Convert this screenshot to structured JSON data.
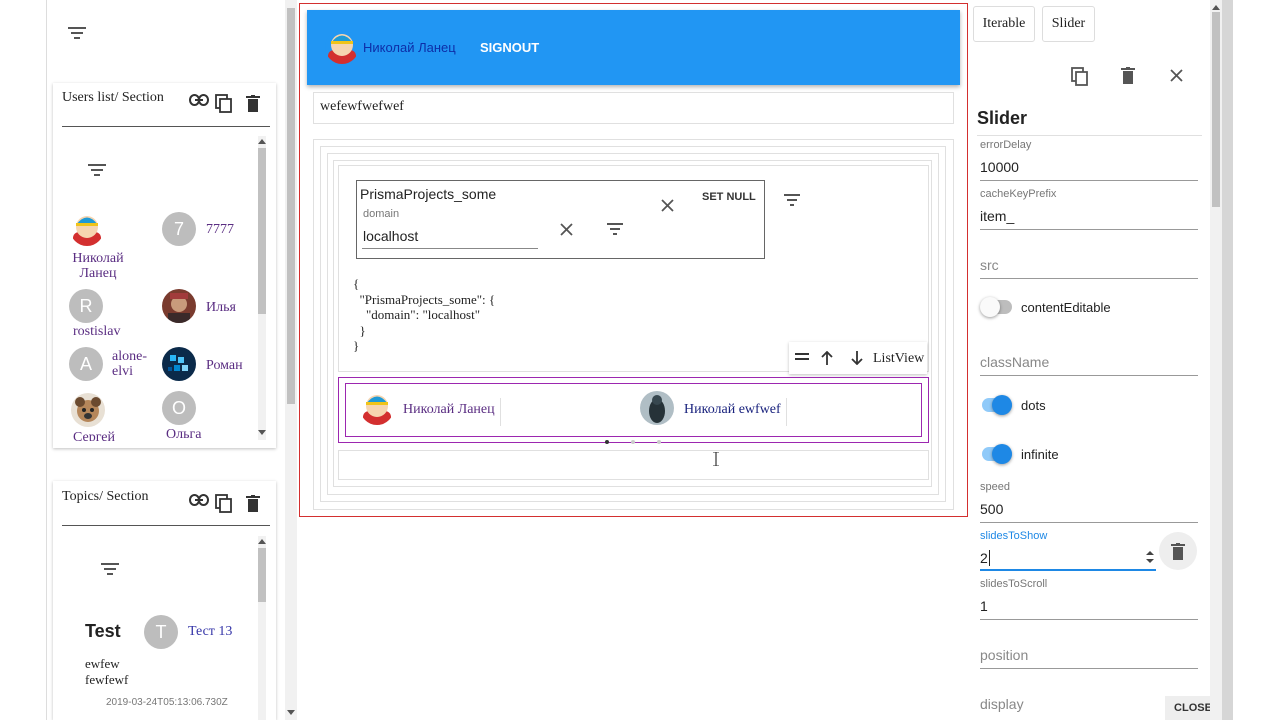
{
  "left": {
    "users_section": {
      "title": "Users list/ Section",
      "users": [
        {
          "name": "Николай\nЛанец",
          "avatar": "cartman-avatar"
        },
        {
          "name": "7777",
          "letter": "7"
        },
        {
          "name": "rostislav",
          "letter": "R"
        },
        {
          "name": "Илья",
          "avatar": "photo-avatar"
        },
        {
          "name": "alone-\nelvi",
          "letter": "A"
        },
        {
          "name": "Роман",
          "avatar": "pixel-avatar"
        },
        {
          "name": "Сергей",
          "avatar": "dog-avatar"
        },
        {
          "name": "Ольга",
          "letter": "O"
        }
      ]
    },
    "topics_section": {
      "title": "Topics/ Section",
      "topic_title": "Test",
      "topic_body": "ewfew\nfewfewf",
      "topic_date": "2019-03-24T05:13:06.730Z",
      "user_letter": "T",
      "user_name": "Тест 13"
    }
  },
  "header": {
    "user_name": "Николай Ланец",
    "signout_label": "SIGNOUT",
    "accent": "#2196f3"
  },
  "main": {
    "text_field_value": "wefewfwefwef",
    "filter_form": {
      "title": "PrismaProjects_some",
      "domain_label": "domain",
      "domain_value": "localhost",
      "set_null_label": "SET NULL"
    },
    "json_preview": "{\n  \"PrismaProjects_some\": {\n    \"domain\": \"localhost\"\n  }\n}",
    "toolbar_label": "ListView",
    "slider_items": [
      {
        "name": "Николай Ланец"
      },
      {
        "name": "Николай ewfwef"
      }
    ]
  },
  "right": {
    "tabs": [
      "Iterable",
      "Slider"
    ],
    "heading": "Slider",
    "fields": {
      "errorDelay": {
        "label": "errorDelay",
        "value": "10000"
      },
      "cacheKeyPrefix": {
        "label": "cacheKeyPrefix",
        "value": "item_"
      },
      "src": {
        "placeholder": "src"
      },
      "contentEditable": {
        "label": "contentEditable",
        "on": false
      },
      "className": {
        "placeholder": "className"
      },
      "dots": {
        "label": "dots",
        "on": true
      },
      "infinite": {
        "label": "infinite",
        "on": true
      },
      "speed": {
        "label": "speed",
        "value": "500"
      },
      "slidesToShow": {
        "label": "slidesToShow",
        "value": "2"
      },
      "slidesToScroll": {
        "label": "slidesToScroll",
        "value": "1"
      },
      "position": {
        "placeholder": "position"
      },
      "display": {
        "placeholder": "display"
      }
    },
    "close_label": "CLOSE",
    "active_color": "#1e88e5"
  }
}
